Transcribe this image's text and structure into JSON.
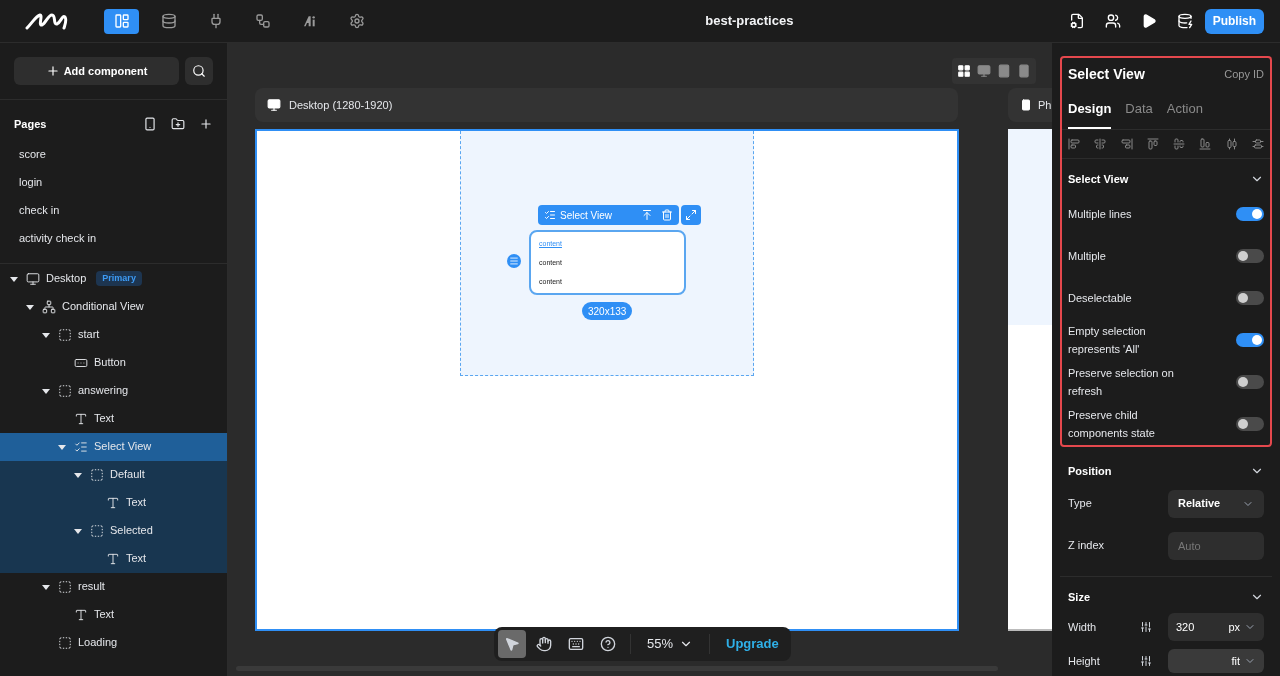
{
  "topbar": {
    "nav": [
      {
        "kind": "pages",
        "selected": true
      },
      {
        "kind": "data",
        "selected": false
      },
      {
        "kind": "api",
        "selected": false
      },
      {
        "kind": "flow",
        "selected": false
      },
      {
        "kind": "ai",
        "selected": false
      },
      {
        "kind": "settings",
        "selected": false
      }
    ],
    "title": "best-practices",
    "actions": [
      {
        "kind": "file-settings"
      },
      {
        "kind": "users"
      },
      {
        "kind": "play"
      },
      {
        "kind": "database-check"
      }
    ],
    "publish": "Publish"
  },
  "sidebar": {
    "add_button": "Add component",
    "pages_title": "Pages",
    "pages": [
      "score",
      "login",
      "check in",
      "activity check in"
    ],
    "tree": [
      {
        "label": "Desktop",
        "kind": "screen",
        "badge": "Primary",
        "expanded": true,
        "selected": false,
        "children": [
          {
            "label": "Conditional View",
            "kind": "conditional",
            "expanded": true,
            "selected": false,
            "children": [
              {
                "label": "start",
                "kind": "container",
                "expanded": true,
                "selected": false,
                "children": [
                  {
                    "label": "Button",
                    "kind": "button",
                    "selected": false
                  }
                ]
              },
              {
                "label": "answering",
                "kind": "container",
                "expanded": true,
                "selected": false,
                "children": [
                  {
                    "label": "Text",
                    "kind": "text",
                    "selected": false
                  },
                  {
                    "label": "Select View",
                    "kind": "select",
                    "expanded": true,
                    "selected": true,
                    "children": [
                      {
                        "label": "Default",
                        "kind": "container",
                        "expanded": true,
                        "selected": false,
                        "children": [
                          {
                            "label": "Text",
                            "kind": "text",
                            "selected": false
                          }
                        ]
                      },
                      {
                        "label": "Selected",
                        "kind": "container",
                        "expanded": true,
                        "selected": false,
                        "children": [
                          {
                            "label": "Text",
                            "kind": "text",
                            "selected": false
                          }
                        ]
                      }
                    ]
                  }
                ]
              },
              {
                "label": "result",
                "kind": "container",
                "expanded": true,
                "selected": false,
                "children": [
                  {
                    "label": "Text",
                    "kind": "text",
                    "selected": false
                  }
                ]
              },
              {
                "label": "Loading",
                "kind": "container",
                "selected": false
              }
            ]
          }
        ]
      }
    ]
  },
  "canvas": {
    "view_modes": [
      {
        "kind": "grid",
        "selected": true
      },
      {
        "kind": "desktop",
        "selected": false
      },
      {
        "kind": "tablet",
        "selected": false
      },
      {
        "kind": "phone",
        "selected": false
      }
    ],
    "desktop_frame": "Desktop (1280-1920)",
    "phone_frame": "Ph",
    "widget": {
      "label": "Select View",
      "items": [
        {
          "text": "content",
          "selected": true
        },
        {
          "text": "content",
          "selected": false
        },
        {
          "text": "content",
          "selected": false
        }
      ],
      "size": "320x133"
    },
    "tools": [
      {
        "kind": "pointer",
        "selected": true
      },
      {
        "kind": "hand",
        "selected": false
      },
      {
        "kind": "keyboard",
        "selected": false
      },
      {
        "kind": "help",
        "selected": false
      }
    ],
    "zoom": "55%",
    "upgrade": "Upgrade"
  },
  "inspector": {
    "title": "Select View",
    "copy_id": "Copy ID",
    "tabs": [
      {
        "label": "Design",
        "selected": true
      },
      {
        "label": "Data",
        "selected": false
      },
      {
        "label": "Action",
        "selected": false
      }
    ],
    "section": "Select View",
    "toggles": [
      {
        "label": "Multiple lines",
        "on": true
      },
      {
        "label": "Multiple",
        "on": false
      },
      {
        "label": "Deselectable",
        "on": false
      },
      {
        "label": "Empty selection represents 'All'",
        "on": true
      },
      {
        "label": "Preserve selection on refresh",
        "on": false
      },
      {
        "label": "Preserve child components state",
        "on": false
      }
    ],
    "position": {
      "title": "Position",
      "type_label": "Type",
      "type_value": "Relative",
      "z_label": "Z index",
      "z_placeholder": "Auto"
    },
    "size": {
      "title": "Size",
      "width_label": "Width",
      "width_value": "320",
      "width_unit": "px",
      "height_label": "Height",
      "height_value": "fit"
    }
  }
}
